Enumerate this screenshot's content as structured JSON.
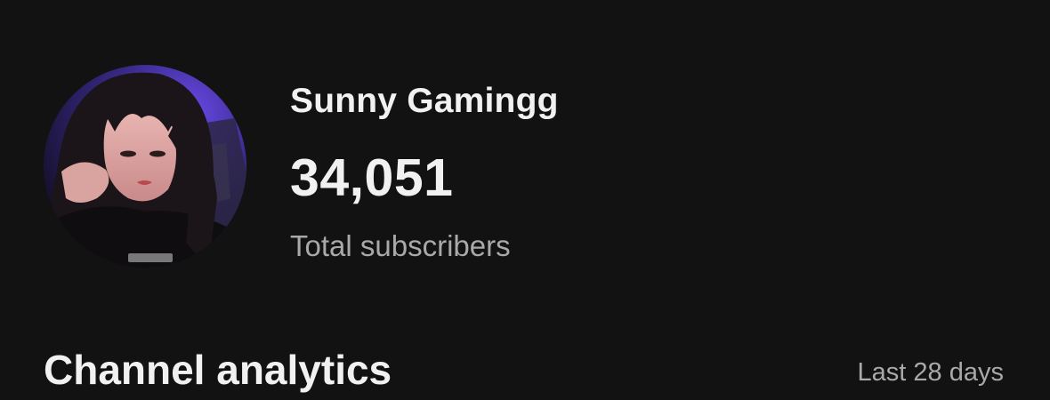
{
  "channel": {
    "name": "Sunny Gamingg",
    "subscriber_count": "34,051",
    "subscriber_label": "Total subscribers"
  },
  "analytics": {
    "title": "Channel analytics",
    "period": "Last 28 days"
  },
  "colors": {
    "background": "#121212",
    "primary_text": "#f1f1f1",
    "secondary_text": "#a9a9a9",
    "avatar_backlight": "#5b3fd6"
  }
}
